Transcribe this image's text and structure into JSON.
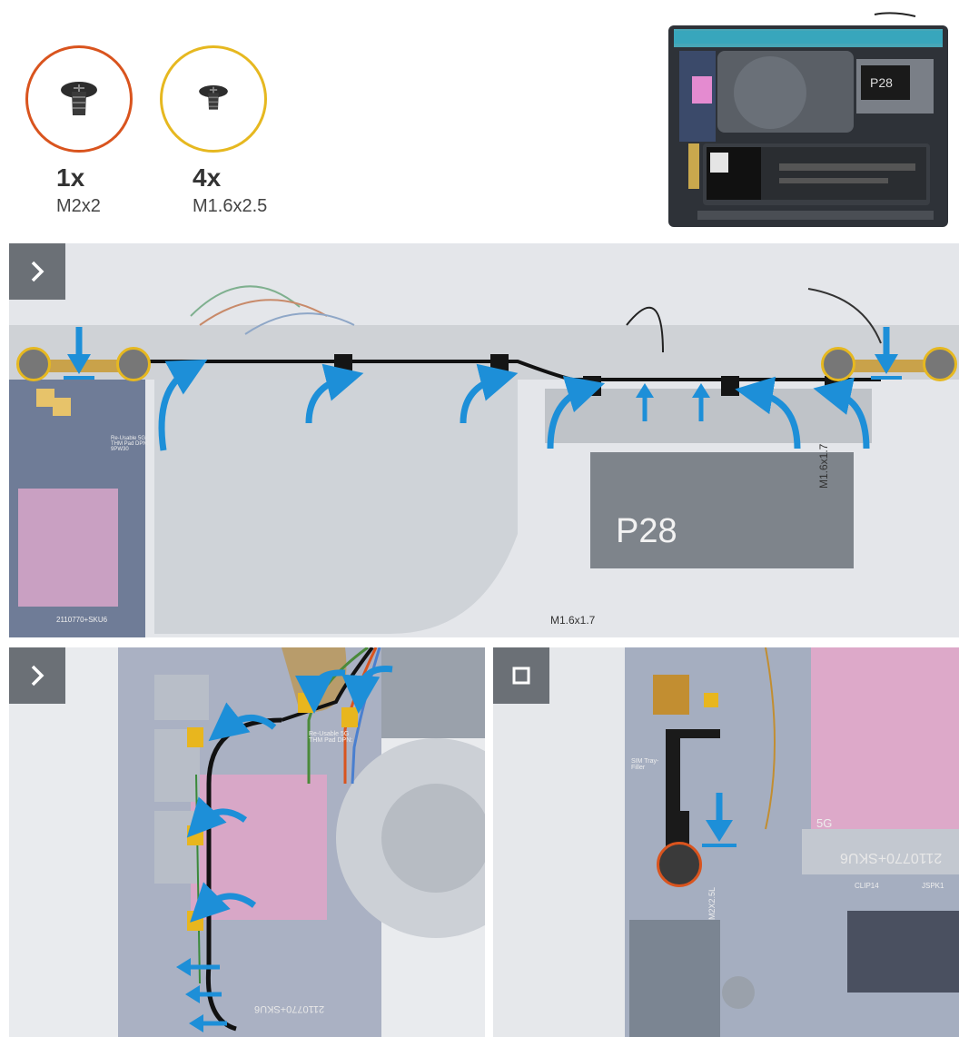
{
  "screws": [
    {
      "quantity": "1x",
      "size": "M2x2",
      "color": "#d9541e"
    },
    {
      "quantity": "4x",
      "size": "M1.6x2.5",
      "color": "#e6b820"
    }
  ],
  "overview": {
    "shield_label": "P28"
  },
  "step1": {
    "shield_label": "P28",
    "screw_label_vertical": "M1.6x1.7",
    "screw_label_bottom": "M1.6x1.7",
    "pad_label": "Re-Usable 5G THM Pad DPN: 9PW30",
    "board_code": "2110770+SKU6"
  },
  "step2": {
    "board_code": "2110770+SKU6",
    "pad_label": "Re-Usable 5G THM Pad DPN:"
  },
  "step3": {
    "board_code": "2110770+SKU6",
    "slot_label": "5G",
    "connector_label": "JSPK1",
    "clip_label": "CLIP14",
    "sim_label": "SIM Tray-Filler",
    "screw_label": "M2X2.5L"
  },
  "colors": {
    "arrow": "#1d8fd8",
    "screw_gold": "#e6b820",
    "screw_orange": "#d9541e",
    "button": "#6b7076"
  }
}
